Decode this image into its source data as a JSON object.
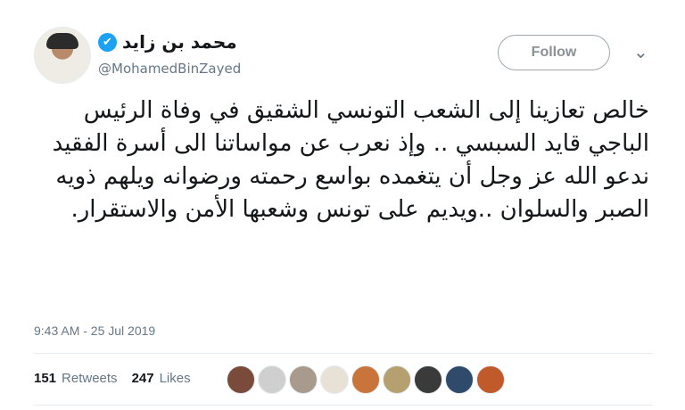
{
  "author": {
    "name": "محمد بن زايد",
    "handle": "@MohamedBinZayed",
    "verified_icon": "✔"
  },
  "follow_label": "Follow",
  "menu_icon": "⌄",
  "tweet": {
    "text": "خالص تعازينا إلى الشعب التونسي الشقيق في وفاة الرئيس الباجي قايد السبسي .. وإذ نعرب عن مواساتنا الى أسرة الفقيد ندعو الله عز وجل أن يتغمده بواسع رحمته ورضوانه ويلهم ذويه الصبر والسلوان ..ويديم على تونس وشعبها الأمن والاستقرار.",
    "timestamp": "9:43 AM - 25 Jul 2019"
  },
  "stats": {
    "retweets_count": "151",
    "retweets_label": "Retweets",
    "likes_count": "247",
    "likes_label": "Likes"
  },
  "likers": [
    {
      "name": "liker-avatar-1",
      "color": "#7a4a3a"
    },
    {
      "name": "liker-avatar-2",
      "color": "#cfcfcf"
    },
    {
      "name": "liker-avatar-3",
      "color": "#a89a8c"
    },
    {
      "name": "liker-avatar-4",
      "color": "#e8e2d6"
    },
    {
      "name": "liker-avatar-5",
      "color": "#c8743a"
    },
    {
      "name": "liker-avatar-6",
      "color": "#b6a070"
    },
    {
      "name": "liker-avatar-7",
      "color": "#3a3a3a"
    },
    {
      "name": "liker-avatar-8",
      "color": "#2f4a6a"
    },
    {
      "name": "liker-avatar-9",
      "color": "#c05a2a"
    }
  ]
}
